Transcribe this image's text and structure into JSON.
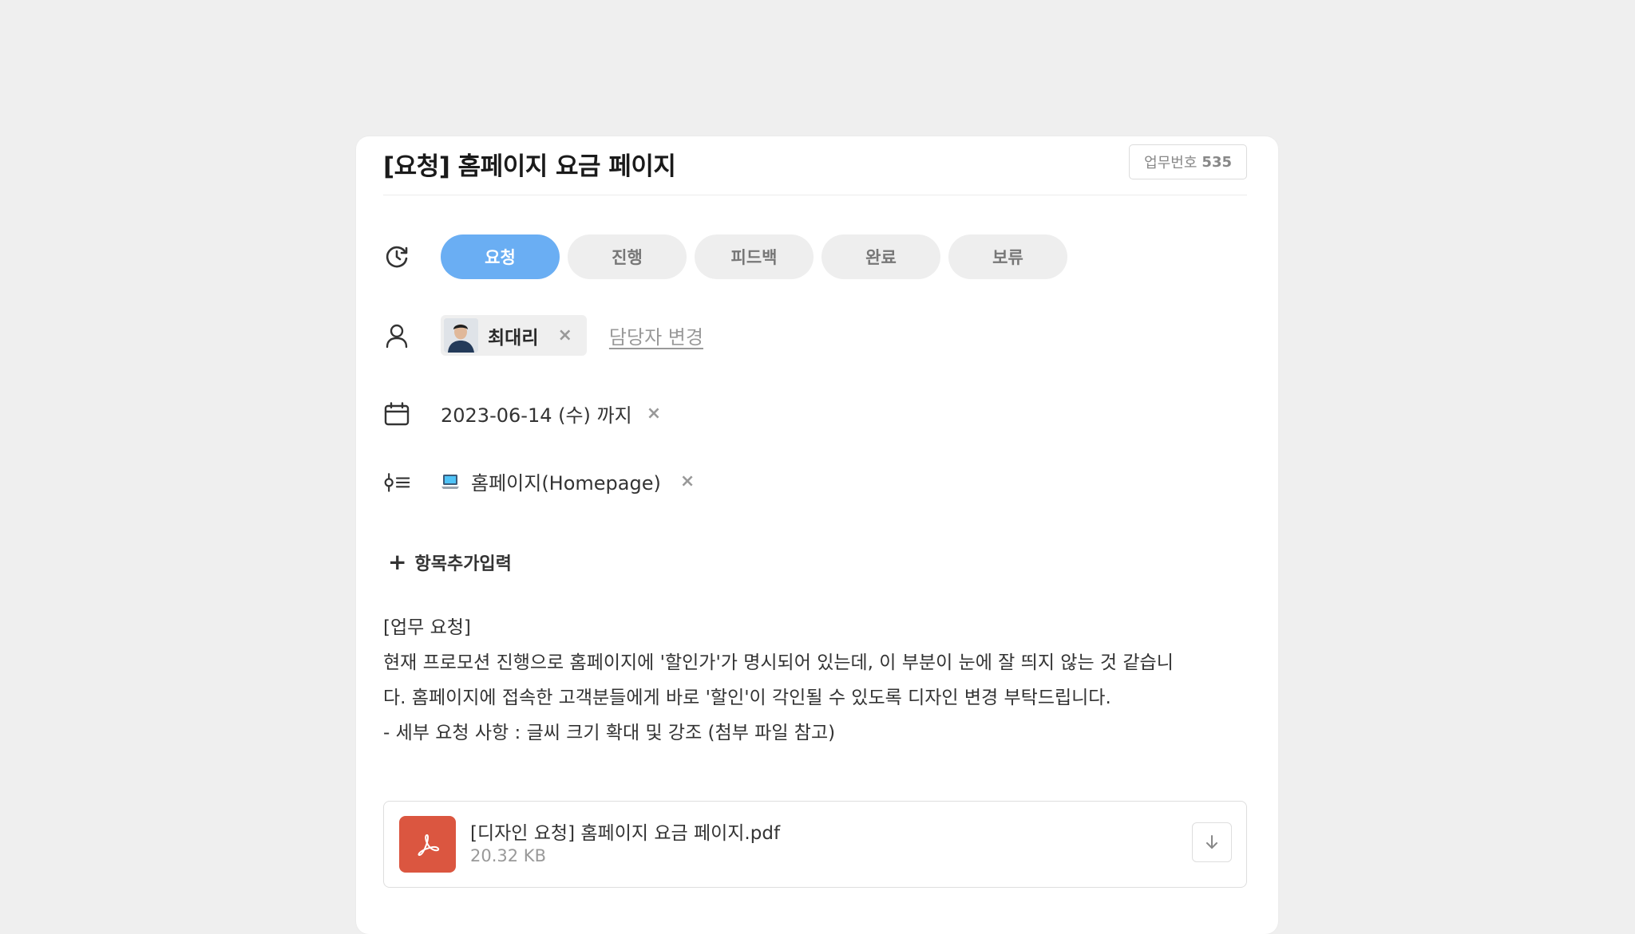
{
  "task": {
    "title": "[요청] 홈페이지 요금 페이지",
    "number_label": "업무번호",
    "number": "535"
  },
  "status": {
    "options": [
      "요청",
      "진행",
      "피드백",
      "완료",
      "보류"
    ],
    "selected": "요청",
    "active_color": "#6aaef3"
  },
  "assignee": {
    "name": "최대리",
    "remove_label": "×",
    "change_label": "담당자 변경"
  },
  "due_date": {
    "text": "2023-06-14 (수) 까지",
    "remove_label": "×"
  },
  "category": {
    "icon": "laptop-icon",
    "text": "홈페이지(Homepage)",
    "remove_label": "×"
  },
  "add_field": {
    "label": "항목추가입력"
  },
  "description": {
    "lines": [
      "[업무 요청]",
      "현재 프로모션 진행으로 홈페이지에 '할인가'가 명시되어 있는데, 이 부분이 눈에 잘 띄지 않는 것 같습니",
      "다. 홈페이지에 접속한 고객분들에게 바로 '할인'이 각인될 수 있도록 디자인 변경 부탁드립니다.",
      "- 세부 요청 사항 :  글씨 크기 확대 및 강조 (첨부 파일 참고)"
    ]
  },
  "attachment": {
    "name": "[디자인 요청] 홈페이지 요금 페이지.pdf",
    "size": "20.32 KB",
    "icon_color": "#db5640"
  }
}
